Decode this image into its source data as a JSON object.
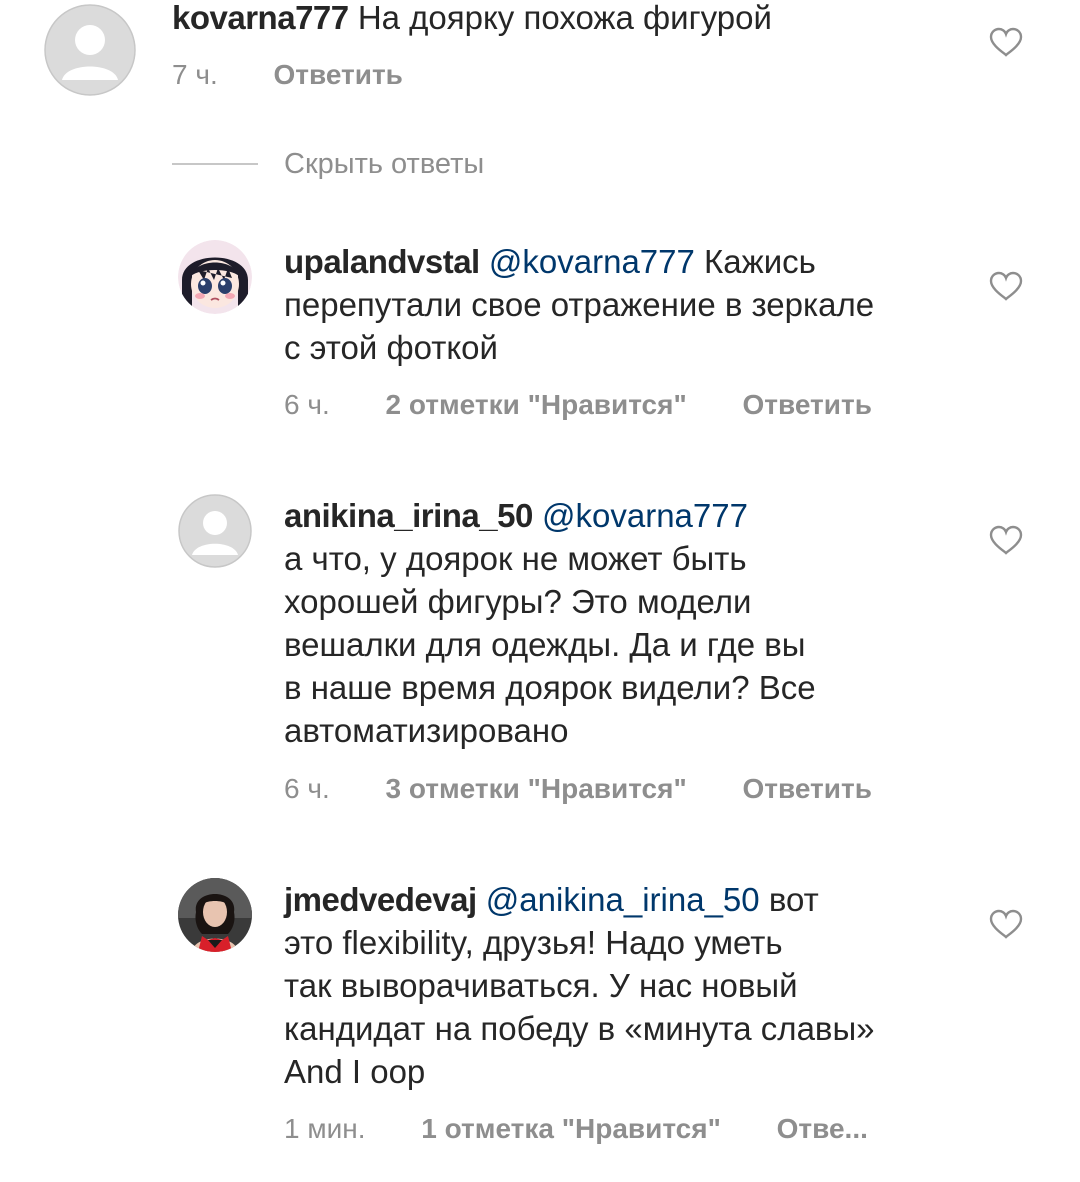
{
  "comments": [
    {
      "username": "kovarna777",
      "mention": "",
      "lines": [
        "На доярку похожа фигурой"
      ],
      "time": "7 ч.",
      "likes": "",
      "reply": "Ответить",
      "avatar_icon": "default-avatar-icon"
    }
  ],
  "hide_replies": "Скрыть ответы",
  "replies": [
    {
      "username": "upalandvstal",
      "mention": "@kovarna777",
      "first_line_rest": "Кажись",
      "lines": [
        "перепутали свое отражение в зеркале",
        "с этой фоткой"
      ],
      "time": "6 ч.",
      "likes": "2 отметки \"Нравится\"",
      "reply": "Ответить",
      "avatar_icon": "anime-girl-avatar-icon"
    },
    {
      "username": "anikina_irina_50",
      "mention": "@kovarna777",
      "first_line_rest": "",
      "lines": [
        "а что, у доярок не может быть",
        "хорошей фигуры? Это модели",
        "вешалки для одежды. Да и где вы",
        "в наше время доярок видели? Все",
        "автоматизировано"
      ],
      "time": "6 ч.",
      "likes": "3 отметки \"Нравится\"",
      "reply": "Ответить",
      "avatar_icon": "default-avatar-icon"
    },
    {
      "username": "jmedvedevaj",
      "mention": "@anikina_irina_50",
      "first_line_rest": "вот",
      "lines": [
        "это flexibility, друзья! Надо уметь",
        "так выворачиваться. У нас новый",
        "кандидат на победу в «минута славы»",
        "And I oop"
      ],
      "time": "1 мин.",
      "likes": "1 отметка \"Нравится\"",
      "reply": "Отве...",
      "avatar_icon": "photo-avatar-icon"
    }
  ],
  "colors": {
    "text": "#262626",
    "muted": "#8e8e8e",
    "mention": "#00376b",
    "divider": "#c7c7c7"
  }
}
